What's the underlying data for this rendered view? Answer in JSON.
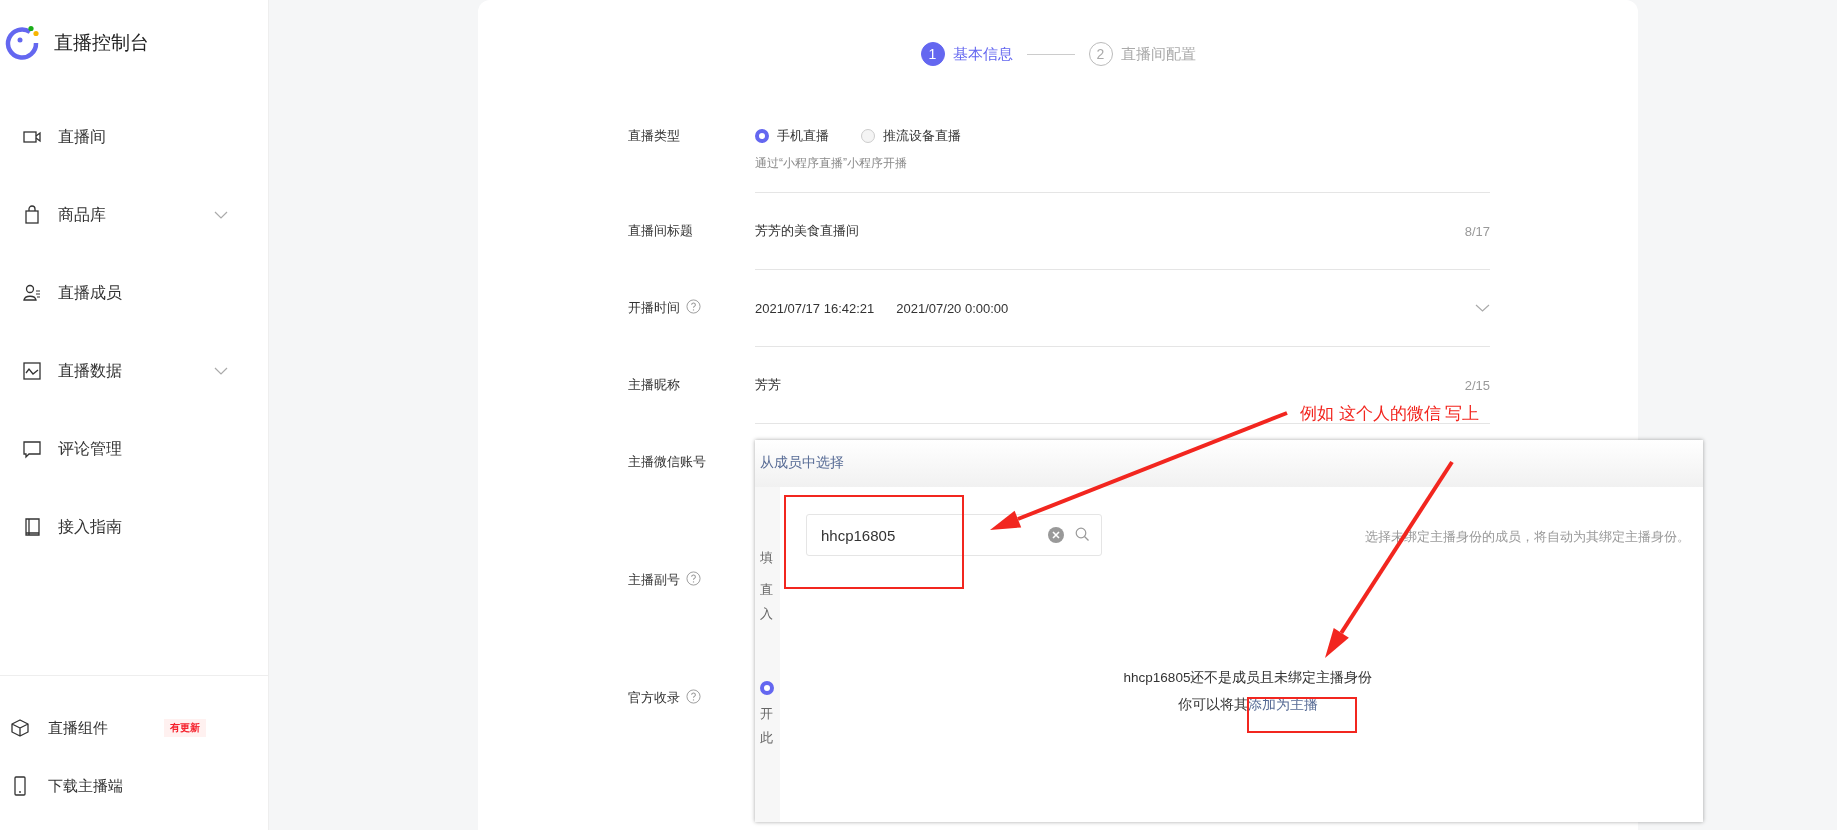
{
  "sidebar": {
    "title": "直播控制台",
    "items": [
      {
        "label": "直播间",
        "kind": "video",
        "expandable": false
      },
      {
        "label": "商品库",
        "kind": "bag",
        "expandable": true
      },
      {
        "label": "直播成员",
        "kind": "person",
        "expandable": false
      },
      {
        "label": "直播数据",
        "kind": "chart",
        "expandable": true
      },
      {
        "label": "评论管理",
        "kind": "comment",
        "expandable": false
      },
      {
        "label": "接入指南",
        "kind": "book",
        "expandable": false
      }
    ],
    "footer_items": [
      {
        "label": "直播组件",
        "kind": "cube",
        "badge": "有更新"
      },
      {
        "label": "下载主播端",
        "kind": "phone"
      }
    ]
  },
  "steps": [
    {
      "number": "1",
      "label": "基本信息",
      "selected": true
    },
    {
      "number": "2",
      "label": "直播间配置",
      "selected": false
    }
  ],
  "form": {
    "rows": [
      {
        "kind": "radio",
        "label": "直播类型",
        "help": false,
        "options": [
          {
            "label": "手机直播",
            "selected": true
          },
          {
            "label": "推流设备直播",
            "selected": false
          }
        ],
        "hint": "通过“小程序直播”小程序开播"
      },
      {
        "kind": "text",
        "label": "直播间标题",
        "help": false,
        "value": "芳芳的美食直播间",
        "counter": "8/17"
      },
      {
        "kind": "datetime",
        "label": "开播时间",
        "help": true,
        "start": "2021/07/17 16:42:21",
        "end": "2021/07/20 0:00:00"
      },
      {
        "kind": "text",
        "label": "主播昵称",
        "help": false,
        "value": "芳芳",
        "counter": "2/15"
      },
      {
        "kind": "covered",
        "label": "主播微信账号",
        "help": false
      },
      {
        "kind": "covered",
        "label": "主播副号",
        "help": true
      },
      {
        "kind": "covered",
        "label": "官方收录",
        "help": true
      }
    ]
  },
  "popup": {
    "link": "从成员中选择",
    "behind_fragments": [
      {
        "kind": "text",
        "text": "填"
      },
      {
        "kind": "text",
        "text": "直"
      },
      {
        "kind": "text",
        "text": "入"
      },
      {
        "kind": "radio",
        "selected": true
      },
      {
        "kind": "text",
        "text": "开"
      },
      {
        "kind": "text",
        "text": "此"
      }
    ],
    "search": {
      "value": "hhcp16805"
    },
    "hint": "选择未绑定主播身份的成员，将自动为其绑定主播身份。",
    "message": "hhcp16805还不是成员且未绑定主播身份",
    "message_prefix": "你可以将其",
    "message_link": "添加为主播"
  },
  "annotation": {
    "note": "例如 这个人的微信 写上"
  }
}
